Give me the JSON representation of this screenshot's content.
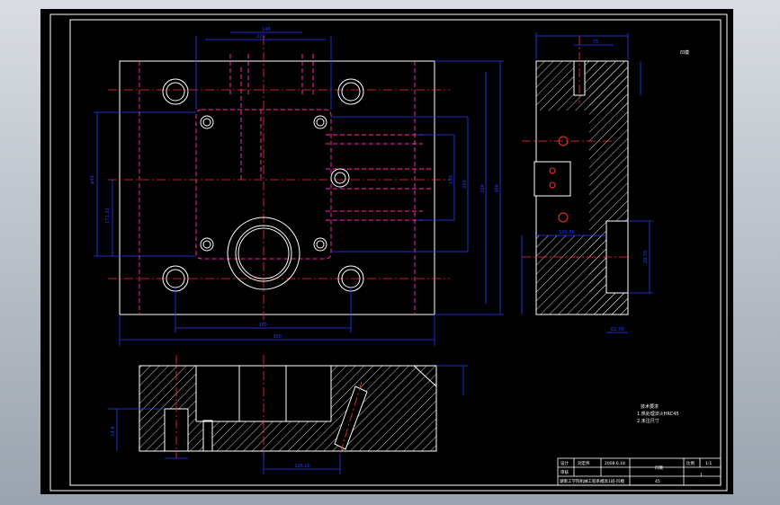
{
  "colors": {
    "background": "#000000",
    "frame": "#ffffff",
    "outline": "#ffffff",
    "hidden": "#ff2aa8",
    "dimension": "#2a3cff",
    "center": "#ff3030",
    "hatch": "#ffffff"
  },
  "top_view": {
    "dim_top_a": "220",
    "dim_top_b": "146",
    "dim_bottom_a": "260",
    "dim_bottom_b": "350",
    "dim_left_a": "φ40",
    "dim_left_b": "171.31",
    "dim_right_a": "190",
    "dim_right_b": "220",
    "dim_right_c": "260",
    "dim_right_d": "300"
  },
  "side_view": {
    "dim_top": "75",
    "dim_width": "100.50",
    "dim_bottom": "62.70",
    "dim_vertical": "29.76"
  },
  "section_view": {
    "dim_bottom": "126.10",
    "dim_left": "24.6"
  },
  "notes": {
    "title": "技术要求",
    "line1": "1.热处理淬火HRC45",
    "line2": "2.未注尺寸"
  },
  "title_block": {
    "row1_col1": "设计",
    "row1_col2": "刘宏伟",
    "row1_col3": "2008.6.18",
    "name": "凹模",
    "ratio_label": "比例",
    "ratio_value": "1:1",
    "row2_col1": "审核",
    "row2_col2": "1",
    "school": "湖南工学院机械工程系模具1班-凹模",
    "material": "45"
  },
  "corner_note": "凹模"
}
